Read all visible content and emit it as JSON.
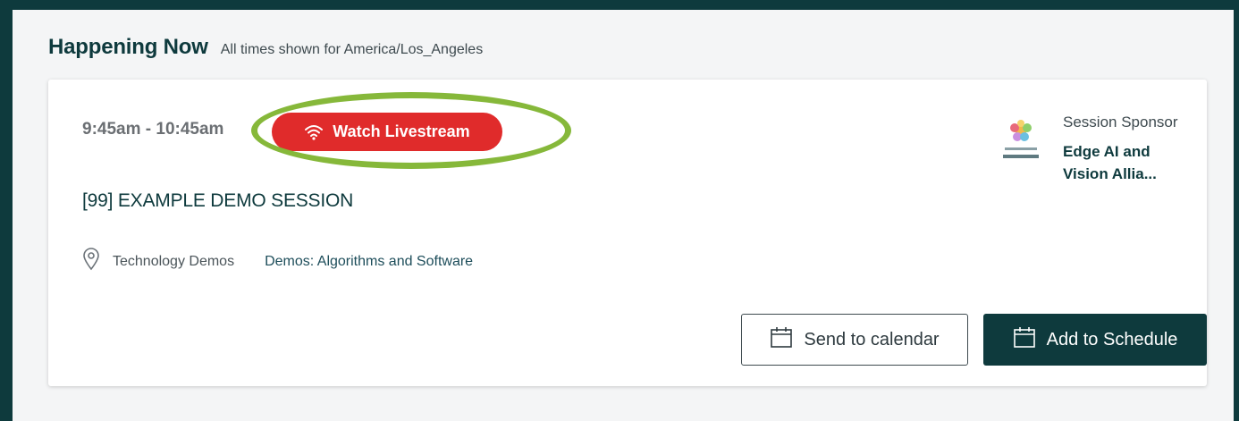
{
  "header": {
    "title": "Happening Now",
    "timezone_note": "All times shown for America/Los_Angeles"
  },
  "session": {
    "time": "9:45am - 10:45am",
    "livestream_label": "Watch Livestream",
    "title": "[99] EXAMPLE DEMO SESSION",
    "location": "Technology Demos",
    "track": "Demos: Algorithms and Software"
  },
  "sponsor": {
    "label": "Session Sponsor",
    "name": "Edge AI and Vision Allia..."
  },
  "actions": {
    "send_to_calendar": "Send to calendar",
    "add_to_schedule": "Add to Schedule"
  },
  "colors": {
    "brand_dark": "#0e3a3d",
    "live_red": "#e02b2b",
    "highlight_green": "#86b83a"
  },
  "icons": {
    "livestream": "wifi-icon",
    "location": "map-pin-icon",
    "calendar": "calendar-icon"
  }
}
